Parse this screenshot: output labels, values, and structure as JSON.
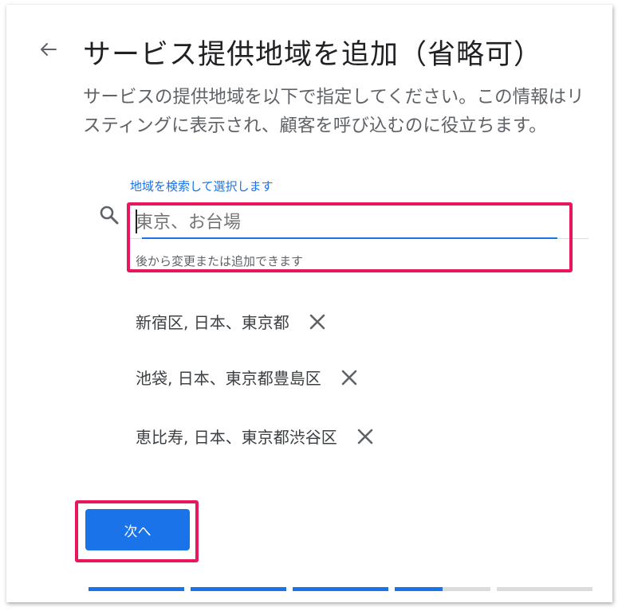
{
  "header": {
    "title": "サービス提供地域を追加（省略可）",
    "back_icon": "arrow-back-icon"
  },
  "description": "サービスの提供地域を以下で指定してください。この情報はリスティングに表示され、顧客を呼び込むのに役立ちます。",
  "search": {
    "label": "地域を検索して選択します",
    "value": "",
    "placeholder": "東京、お台場",
    "helper": "後から変更または追加できます",
    "icon": "search-icon"
  },
  "areas": [
    {
      "label": "新宿区, 日本、東京都"
    },
    {
      "label": "池袋, 日本、東京都豊島区"
    },
    {
      "label": "恵比寿, 日本、東京都渋谷区"
    }
  ],
  "next_button": {
    "label": "次へ"
  },
  "progress": {
    "steps": [
      1,
      1,
      1,
      0.5,
      0
    ],
    "color_done": "#1a73e8",
    "color_todo": "#dadce0"
  },
  "colors": {
    "accent": "#1a73e8",
    "highlight": "#e8175d"
  }
}
